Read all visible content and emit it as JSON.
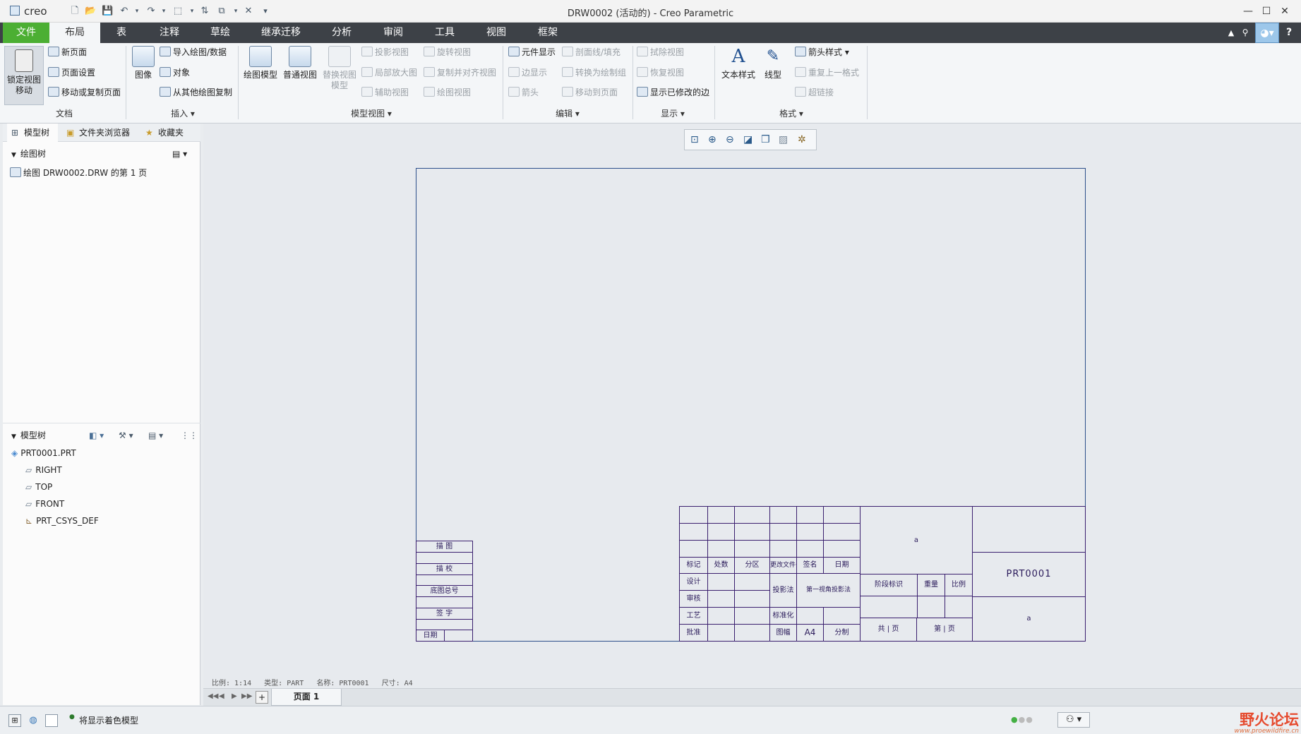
{
  "app": {
    "logo": "creo",
    "title": "DRW0002 (活动的) - Creo Parametric"
  },
  "tabs": [
    "文件",
    "布局",
    "表",
    "注释",
    "草绘",
    "继承迁移",
    "分析",
    "审阅",
    "工具",
    "视图",
    "框架"
  ],
  "ribbon": {
    "lock_view_move": "锁定视图\n移动",
    "new_page": "新页面",
    "page_setup": "页面设置",
    "move_copy_page": "移动或复制页面",
    "image": "图像",
    "import_drawing": "导入绘图/数据",
    "object": "对象",
    "copy_from_drawing": "从其他绘图复制",
    "drawing_model": "绘图模型",
    "general_view": "普通视图",
    "replace_view_model": "替换视图\n模型",
    "projection_view": "投影视图",
    "detailed_view": "局部放大图",
    "auxiliary_view": "辅助视图",
    "revolved_view": "旋转视图",
    "copy_align_view": "复制并对齐视图",
    "drawing_view": "绘图视图",
    "element_display": "元件显示",
    "edge_display": "边显示",
    "arrow": "箭头",
    "section_fill": "剖面线/填充",
    "convert_to_draft": "转换为绘制组",
    "move_to_page": "移动到页面",
    "erase_view": "拭除视图",
    "resume_view": "恢复视图",
    "show_modified_edges": "显示已修改的边",
    "text_style": "文本样式",
    "line_style": "线型",
    "arrow_style": "箭头样式",
    "repeat_format": "重复上一格式",
    "hyperlink": "超链接",
    "groups": {
      "document": "文档",
      "insert": "插入",
      "model_views": "模型视图",
      "edit": "编辑",
      "display": "显示",
      "format": "格式"
    }
  },
  "left": {
    "tabs": [
      "模型树",
      "文件夹浏览器",
      "收藏夹"
    ],
    "drawing_tree_title": "绘图树",
    "drawing_tree_item": "绘图 DRW0002.DRW 的第 1 页",
    "model_tree_title": "模型树",
    "model_tree_items": [
      "PRT0001.PRT",
      "RIGHT",
      "TOP",
      "FRONT",
      "PRT_CSYS_DEF"
    ]
  },
  "titleblock": {
    "left_rows": [
      "描 图",
      "描 校",
      "底图总号",
      "签 字",
      "日期"
    ],
    "headers": [
      "标记",
      "处数",
      "分区",
      "更改文件号",
      "签名",
      "日期"
    ],
    "roles": [
      "设计",
      "审核",
      "工艺",
      "批准"
    ],
    "projection_label": "投影法",
    "projection_value": "第一视角投影法",
    "standardization": "标准化",
    "format_label": "图幅",
    "format_value": "A4",
    "division": "分制",
    "stage": "阶段标识",
    "weight": "重量",
    "scale": "比例",
    "part_name": "PRT0001",
    "a_top": "a",
    "a_right": "a",
    "total": "共  |  页",
    "page": "第  |  页"
  },
  "canvas_info": "比例: 1:14   类型: PART   名称: PRT0001   尺寸: A4",
  "pagebar": {
    "add": "+",
    "page": "页面 1"
  },
  "status": {
    "message": "将显示着色模型"
  },
  "watermark": {
    "brand": "野火论坛",
    "url": "www.proewildfire.cn"
  }
}
